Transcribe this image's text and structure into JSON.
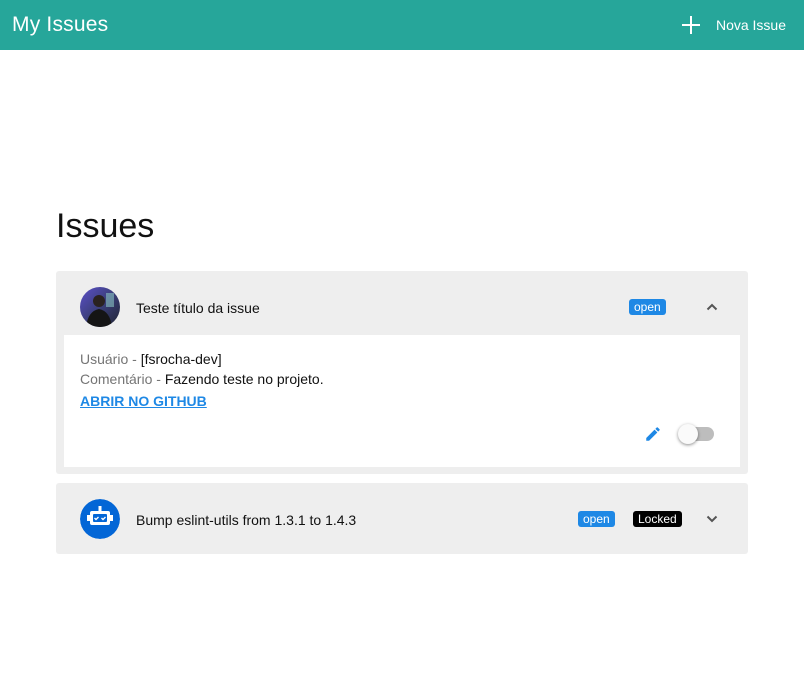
{
  "app": {
    "title": "My Issues"
  },
  "header": {
    "new_issue_label": "Nova Issue",
    "new_issue_icon": "plus-icon"
  },
  "main": {
    "title": "Issues"
  },
  "colors": {
    "appbar": "#26a69a",
    "badge_open": "#1e88e5",
    "badge_locked": "#000000",
    "link": "#1e88e5"
  },
  "issues": [
    {
      "title": "Teste título da issue",
      "avatar_icon": "user-photo-avatar",
      "badge_open": "open",
      "expanded": true,
      "expand_icon": "chevron-up-icon",
      "details": {
        "user_key": "Usuário - ",
        "user_value": "[fsrocha-dev]",
        "comment_key": "Comentário - ",
        "comment_value": "Fazendo teste no projeto.",
        "link_label": "Abrir no github"
      },
      "edit_icon": "pencil-icon",
      "toggle_on": false
    },
    {
      "title": "Bump eslint-utils from 1.3.1 to 1.4.3",
      "avatar_icon": "robot-avatar",
      "badge_open": "open",
      "badge_locked": "Locked",
      "expanded": false,
      "expand_icon": "chevron-down-icon"
    }
  ]
}
